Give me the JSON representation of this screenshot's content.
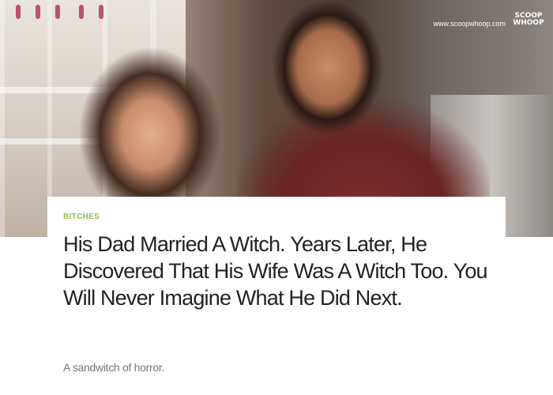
{
  "watermark": {
    "url": "www.scoopwhoop.com",
    "logo_line1": "SCOOP",
    "logo_line2": "WHOOP"
  },
  "article": {
    "category": "BITCHES",
    "headline": "His Dad Married A Witch. Years Later, He Discovered That His Wife Was A Witch Too. You Will Never Imagine What He Did Next.",
    "subtitle": "A sandwitch of horror."
  },
  "colors": {
    "category": "#8bc34a",
    "headline": "#222222",
    "subtitle": "#777777",
    "card_bg": "#ffffff"
  }
}
